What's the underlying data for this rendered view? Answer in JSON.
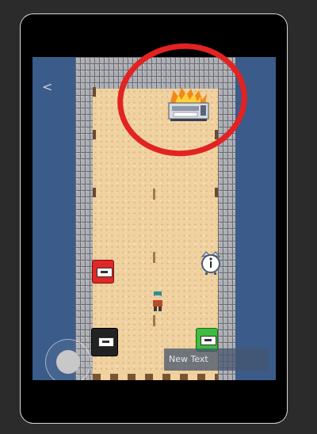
{
  "nav": {
    "back_glyph": "<"
  },
  "hud": {
    "text_box": "New Text"
  },
  "icons": {
    "back": "chevron-left-icon",
    "printer": "burning-printer-icon",
    "alarm_red": "fire-alarm-red-icon",
    "alarm_black": "fire-alarm-black-icon",
    "alarm_green": "fire-alarm-green-icon",
    "info": "info-clock-icon",
    "player": "player-character-icon"
  },
  "colors": {
    "highlight_circle": "#e32222",
    "background": "#3b5b8a",
    "floor": "#f0d2a0"
  }
}
